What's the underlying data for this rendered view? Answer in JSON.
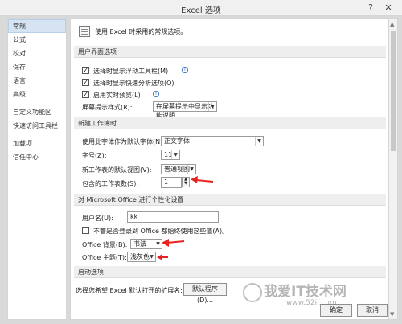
{
  "window": {
    "title": "Excel 选项",
    "help_icon": "?",
    "close_icon": "✕"
  },
  "nav": {
    "items": [
      "常规",
      "公式",
      "校对",
      "保存",
      "语言",
      "高级",
      "自定义功能区",
      "快速访问工具栏",
      "加载项",
      "信任中心"
    ],
    "active_index": 0
  },
  "header": {
    "intro": "使用 Excel 时采用的常规选项。"
  },
  "sections": {
    "ui": "用户界面选项",
    "workbook": "新建工作簿时",
    "personalize": "对 Microsoft Office 进行个性化设置",
    "startup": "启动选项"
  },
  "ui_options": {
    "mini_toolbar": "选择时显示浮动工具栏(M)",
    "quick_analysis": "选择时显示快速分析选项(Q)",
    "live_preview": "启用实时预览(L)",
    "screentip_label": "屏幕提示样式(R):",
    "screentip_value": "在屏幕提示中显示功能说明"
  },
  "workbook": {
    "font_label": "使用此字体作为默认字体(N):",
    "font_value": "正文字体",
    "size_label": "字号(Z):",
    "size_value": "11",
    "view_label": "新工作表的默认视图(V):",
    "view_value": "普通视图",
    "sheets_label": "包含的工作表数(S):",
    "sheets_value": "1"
  },
  "personalize": {
    "username_label": "用户名(U):",
    "username_value": "kk",
    "always_use": "不管是否登录到 Office 都始终使用这些值(A)。",
    "background_label": "Office 背景(B):",
    "background_value": "书法",
    "theme_label": "Office 主题(T):",
    "theme_value": "浅灰色"
  },
  "startup": {
    "ext_label": "选择您希望 Excel 默认打开的扩展名:",
    "default_programs": "默认程序(D)..."
  },
  "footer": {
    "ok": "确定",
    "cancel": "取消"
  },
  "watermark": {
    "text": "我爱IT技术网",
    "url": "www.52ij.com"
  },
  "colors": {
    "accent_red": "#e8231f",
    "nav_active": "#d5e3f2"
  }
}
